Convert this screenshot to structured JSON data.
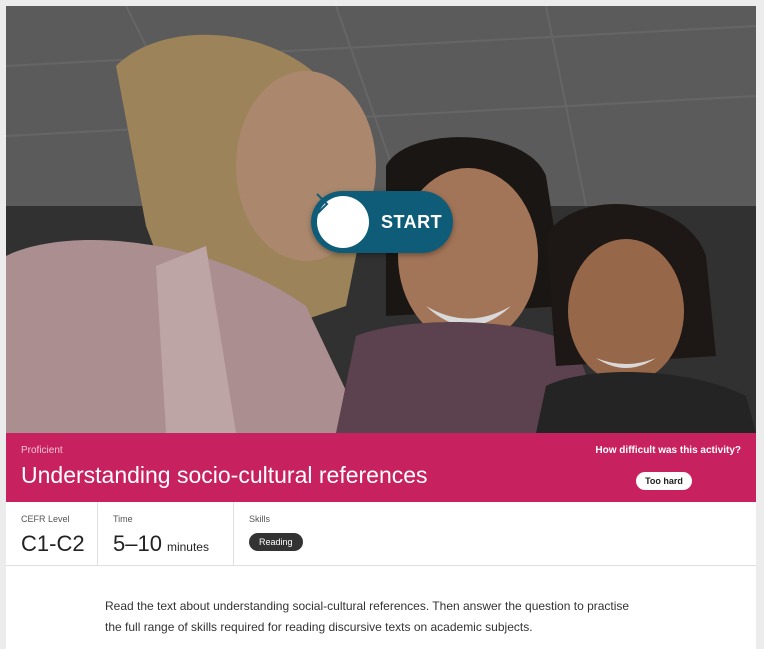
{
  "hero": {
    "start_label": "START",
    "icon": "chevron-right-icon",
    "accent_color": "#0f5c78"
  },
  "activity": {
    "level": "Proficient",
    "title": "Understanding socio-cultural references",
    "difficulty_question": "How difficult was this activity?",
    "difficulty_answer": "Too hard",
    "banner_color": "#c8215f"
  },
  "info": {
    "cefr_label": "CEFR Level",
    "cefr_value": "C1-C2",
    "time_label": "Time",
    "time_value": "5–10",
    "time_unit": "minutes",
    "skills_label": "Skills",
    "skills": [
      "Reading"
    ]
  },
  "description": "Read the text about understanding social-cultural references. Then answer the question to practise the full range of skills required for reading discursive texts on academic subjects."
}
